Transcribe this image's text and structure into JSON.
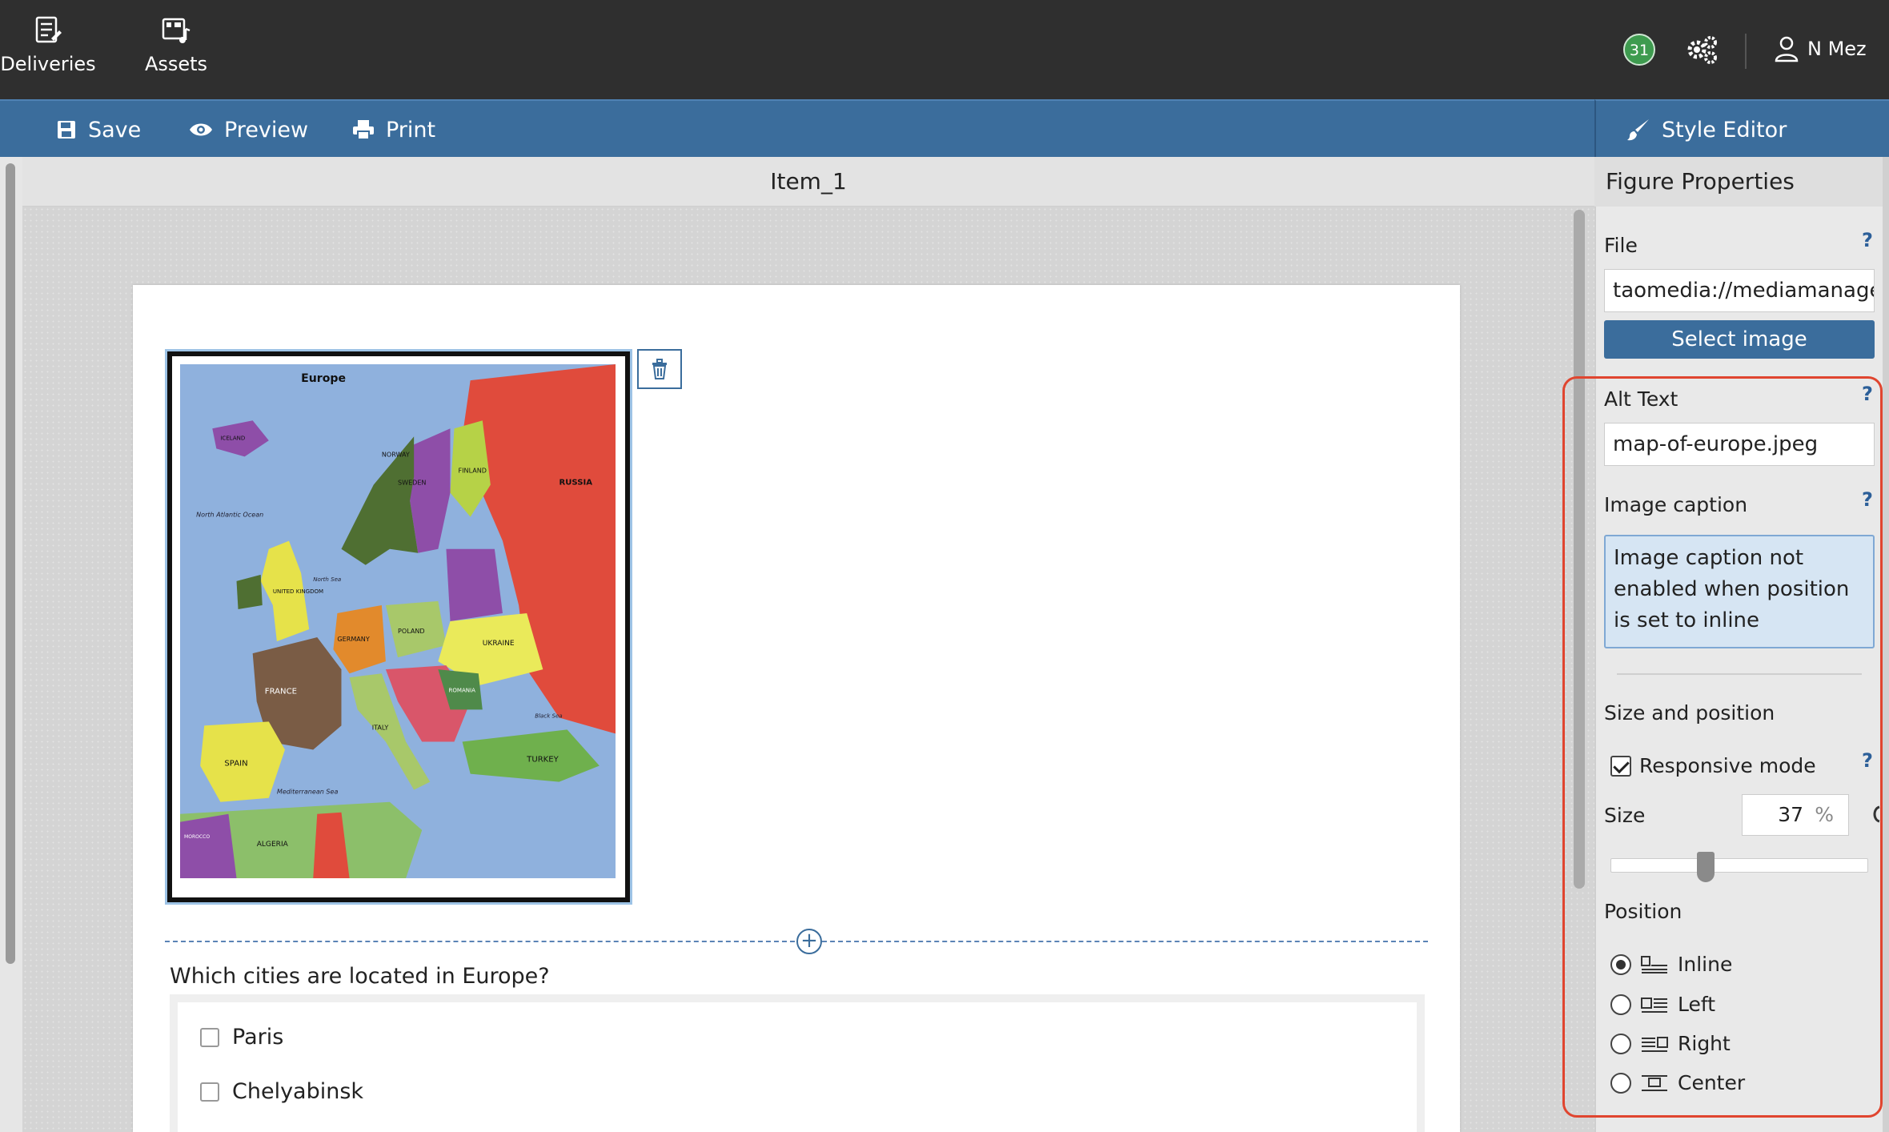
{
  "topnav": {
    "deliveries_label": "Deliveries",
    "assets_label": "Assets",
    "notification_count": "31",
    "user_name": "N Mez"
  },
  "toolbar": {
    "save_label": "Save",
    "preview_label": "Preview",
    "print_label": "Print",
    "style_editor_label": "Style Editor"
  },
  "item": {
    "title": "Item_1",
    "question": "Which cities are located in Europe?",
    "choices": [
      "Paris",
      "Chelyabinsk"
    ]
  },
  "map_labels": {
    "title": "Europe",
    "russia": "RUSSIA",
    "france": "FRANCE",
    "spain": "SPAIN",
    "germany": "GERMANY",
    "ukraine": "UKRAINE",
    "turkey": "TURKEY",
    "algeria": "ALGERIA",
    "norway": "NORWAY",
    "sweden": "SWEDEN",
    "finland": "FINLAND",
    "poland": "POLAND",
    "italy": "ITALY",
    "iceland": "ICELAND",
    "romania": "ROMANIA",
    "united_kingdom": "UNITED KINGDOM",
    "morocco": "MOROCCO",
    "north_atlantic": "North Atlantic Ocean",
    "north_sea": "North Sea",
    "mediterranean": "Mediterranean Sea",
    "black_sea": "Black Sea"
  },
  "panel": {
    "title": "Figure Properties",
    "file_label": "File",
    "file_value": "taomedia://mediamanager/ht",
    "select_image_label": "Select image",
    "alt_text_label": "Alt Text",
    "alt_text_value": "map-of-europe.jpeg",
    "caption_label": "Image caption",
    "caption_info": "Image caption not enabled when position is set to inline",
    "size_position_label": "Size and position",
    "responsive_label": "Responsive mode",
    "size_label": "Size",
    "size_value": "37",
    "size_unit": "%",
    "size_percent": 37,
    "position_label": "Position",
    "positions": [
      "Inline",
      "Left",
      "Right",
      "Center"
    ],
    "selected_position": "Inline",
    "help_glyph": "?"
  },
  "colors": {
    "topbar": "#2f2f2f",
    "toolbar": "#3b6d9c",
    "highlight": "#e0452f",
    "badge": "#3e9b4f"
  }
}
